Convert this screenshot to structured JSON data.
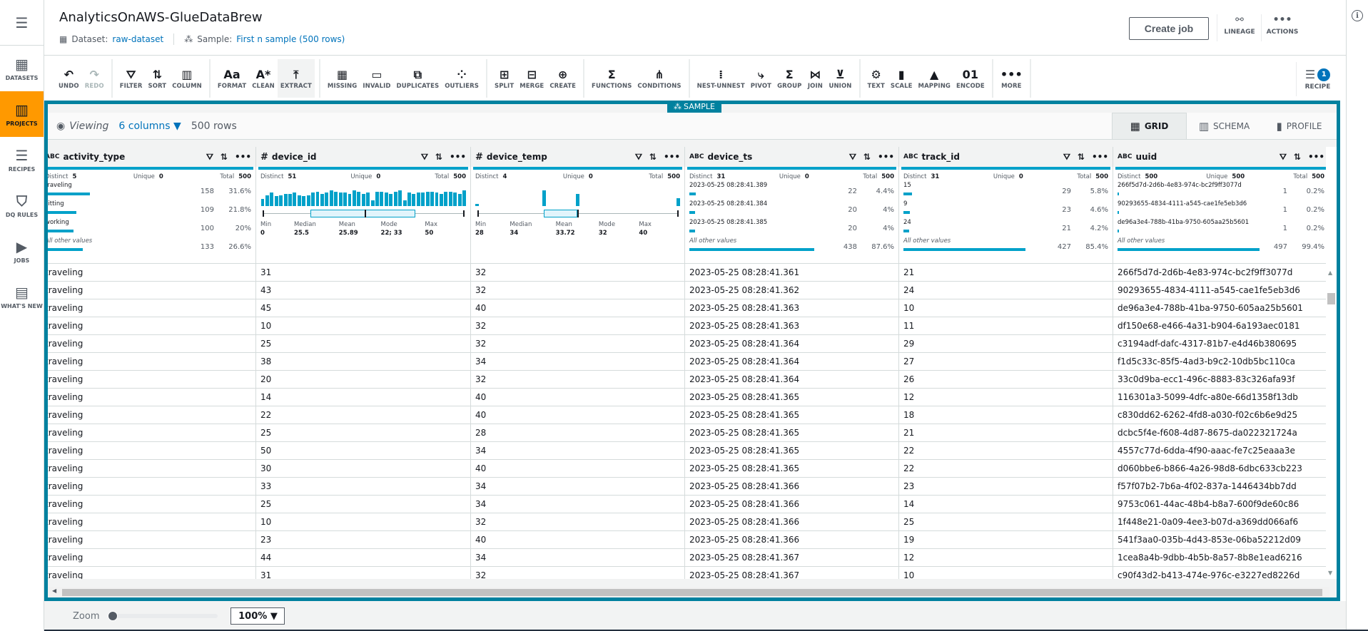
{
  "sidebar": {
    "menu_icon": "☰",
    "items": [
      {
        "label": "DATASETS",
        "icon": "datasets-icon",
        "active": false
      },
      {
        "label": "PROJECTS",
        "icon": "projects-icon",
        "active": true
      },
      {
        "label": "RECIPES",
        "icon": "recipes-icon",
        "active": false
      },
      {
        "label": "DQ RULES",
        "icon": "dq-rules-icon",
        "active": false
      },
      {
        "label": "JOBS",
        "icon": "jobs-icon",
        "active": false
      },
      {
        "label": "WHAT'S NEW",
        "icon": "whats-new-icon",
        "active": false
      }
    ]
  },
  "header": {
    "title": "AnalyticsOnAWS-GlueDataBrew",
    "dataset_label": "Dataset:",
    "dataset_value": "raw-dataset",
    "sample_label": "Sample:",
    "sample_value": "First n sample (500 rows)",
    "create_job": "Create job",
    "lineage": "LINEAGE",
    "actions": "ACTIONS"
  },
  "toolbar": {
    "groups": [
      [
        {
          "label": "UNDO",
          "icon": "↶",
          "disabled": false
        },
        {
          "label": "REDO",
          "icon": "↷",
          "disabled": true
        }
      ],
      [
        {
          "label": "FILTER",
          "icon": "⛛"
        },
        {
          "label": "SORT",
          "icon": "⇅"
        },
        {
          "label": "COLUMN",
          "icon": "▥"
        }
      ],
      [
        {
          "label": "FORMAT",
          "icon": "Aa"
        },
        {
          "label": "CLEAN",
          "icon": "A*"
        },
        {
          "label": "EXTRACT",
          "icon": "⤒",
          "active": true
        }
      ],
      [
        {
          "label": "MISSING",
          "icon": "▦"
        },
        {
          "label": "INVALID",
          "icon": "▭"
        },
        {
          "label": "DUPLICATES",
          "icon": "⧉"
        },
        {
          "label": "OUTLIERS",
          "icon": "⁘"
        }
      ],
      [
        {
          "label": "SPLIT",
          "icon": "⊞"
        },
        {
          "label": "MERGE",
          "icon": "⊟"
        },
        {
          "label": "CREATE",
          "icon": "⊕"
        }
      ],
      [
        {
          "label": "FUNCTIONS",
          "icon": "Σ"
        },
        {
          "label": "CONDITIONS",
          "icon": "⋔"
        }
      ],
      [
        {
          "label": "NEST-UNNEST",
          "icon": "⁞"
        },
        {
          "label": "PIVOT",
          "icon": "⤷"
        },
        {
          "label": "GROUP",
          "icon": "Σ"
        },
        {
          "label": "JOIN",
          "icon": "⋈"
        },
        {
          "label": "UNION",
          "icon": "⊻"
        }
      ],
      [
        {
          "label": "TEXT",
          "icon": "⚙"
        },
        {
          "label": "SCALE",
          "icon": "▮"
        },
        {
          "label": "MAPPING",
          "icon": "▲"
        },
        {
          "label": "ENCODE",
          "icon": "01"
        }
      ],
      [
        {
          "label": "MORE",
          "icon": "•••"
        }
      ]
    ],
    "recipe_label": "RECIPE",
    "recipe_count": "1"
  },
  "frame": {
    "sample_tag": "SAMPLE",
    "viewing": "Viewing",
    "columns_selector": "6 columns ▼",
    "rows": "500 rows",
    "view_tabs": [
      {
        "label": "GRID",
        "active": true
      },
      {
        "label": "SCHEMA",
        "active": false
      },
      {
        "label": "PROFILE",
        "active": false
      }
    ]
  },
  "columns": [
    {
      "name": "activity_type",
      "type": "ABC",
      "distinct": "5",
      "unique": "0",
      "total": "500",
      "top": [
        {
          "v": "traveling",
          "c": "158",
          "p": "31.6%",
          "f": 0.316
        },
        {
          "v": "sitting",
          "c": "109",
          "p": "21.8%",
          "f": 0.218
        },
        {
          "v": "working",
          "c": "100",
          "p": "20%",
          "f": 0.2
        },
        {
          "v": "All other values",
          "c": "133",
          "p": "26.6%",
          "f": 0.266,
          "other": true
        }
      ]
    },
    {
      "name": "device_id",
      "type": "#",
      "distinct": "51",
      "unique": "0",
      "total": "500",
      "numeric": {
        "min": "0",
        "median": "25.5",
        "mean": "25.89",
        "mode": "22; 33",
        "max": "50",
        "range": [
          0,
          50
        ],
        "q1": 12,
        "q3": 38,
        "med": 25.5
      },
      "hist": [
        6,
        9,
        11,
        8,
        9,
        10,
        10,
        11,
        9,
        8,
        9,
        11,
        12,
        10,
        11,
        13,
        12,
        11,
        11,
        10,
        13,
        12,
        10,
        11,
        5,
        12,
        12,
        11,
        10,
        12,
        13,
        5,
        11,
        10,
        11,
        11,
        12,
        12,
        11,
        10,
        12,
        12,
        11,
        10,
        13
      ]
    },
    {
      "name": "device_temp",
      "type": "#",
      "distinct": "4",
      "unique": "0",
      "total": "500",
      "numeric": {
        "min": "28",
        "median": "34",
        "mean": "33.72",
        "mode": "32",
        "max": "40",
        "range": [
          28,
          40
        ],
        "q1": 32,
        "q3": 34,
        "med": 34
      },
      "hist_bars": [
        {
          "x": 28,
          "h": 0.13
        },
        {
          "x": 32,
          "h": 1.0
        },
        {
          "x": 34,
          "h": 0.78
        },
        {
          "x": 40,
          "h": 0.5
        }
      ]
    },
    {
      "name": "device_ts",
      "type": "ABC",
      "distinct": "31",
      "unique": "0",
      "total": "500",
      "top": [
        {
          "v": "2023-05-25 08:28:41.389",
          "c": "22",
          "p": "4.4%",
          "f": 0.044
        },
        {
          "v": "2023-05-25 08:28:41.384",
          "c": "20",
          "p": "4%",
          "f": 0.04
        },
        {
          "v": "2023-05-25 08:28:41.385",
          "c": "20",
          "p": "4%",
          "f": 0.04
        },
        {
          "v": "All other values",
          "c": "438",
          "p": "87.6%",
          "f": 0.876,
          "other": true
        }
      ]
    },
    {
      "name": "track_id",
      "type": "ABC",
      "distinct": "31",
      "unique": "0",
      "total": "500",
      "top": [
        {
          "v": "15",
          "c": "29",
          "p": "5.8%",
          "f": 0.058
        },
        {
          "v": "9",
          "c": "23",
          "p": "4.6%",
          "f": 0.046
        },
        {
          "v": "24",
          "c": "21",
          "p": "4.2%",
          "f": 0.042
        },
        {
          "v": "All other values",
          "c": "427",
          "p": "85.4%",
          "f": 0.854,
          "other": true
        }
      ]
    },
    {
      "name": "uuid",
      "type": "ABC",
      "distinct": "500",
      "unique": "500",
      "total": "500",
      "top": [
        {
          "v": "266f5d7d-2d6b-4e83-974c-bc2f9ff3077d",
          "c": "1",
          "p": "0.2%",
          "f": 0.002
        },
        {
          "v": "90293655-4834-4111-a545-cae1fe5eb3d6",
          "c": "1",
          "p": "0.2%",
          "f": 0.002
        },
        {
          "v": "de96a3e4-788b-41ba-9750-605aa25b5601",
          "c": "1",
          "p": "0.2%",
          "f": 0.002
        },
        {
          "v": "All other values",
          "c": "497",
          "p": "99.4%",
          "f": 0.994,
          "other": true
        }
      ]
    }
  ],
  "stat_labels": {
    "distinct": "Distinct",
    "unique": "Unique",
    "total": "Total",
    "min": "Min",
    "median": "Median",
    "mean": "Mean",
    "mode": "Mode",
    "max": "Max"
  },
  "rows": [
    [
      "traveling",
      "31",
      "32",
      "2023-05-25 08:28:41.361",
      "21",
      "266f5d7d-2d6b-4e83-974c-bc2f9ff3077d"
    ],
    [
      "traveling",
      "43",
      "32",
      "2023-05-25 08:28:41.362",
      "24",
      "90293655-4834-4111-a545-cae1fe5eb3d6"
    ],
    [
      "traveling",
      "45",
      "40",
      "2023-05-25 08:28:41.363",
      "10",
      "de96a3e4-788b-41ba-9750-605aa25b5601"
    ],
    [
      "traveling",
      "10",
      "32",
      "2023-05-25 08:28:41.363",
      "11",
      "df150e68-e466-4a31-b904-6a193aec0181"
    ],
    [
      "traveling",
      "25",
      "32",
      "2023-05-25 08:28:41.364",
      "29",
      "c3194adf-dafc-4317-81b7-e4d46b380695"
    ],
    [
      "traveling",
      "38",
      "34",
      "2023-05-25 08:28:41.364",
      "27",
      "f1d5c33c-85f5-4ad3-b9c2-10db5bc110ca"
    ],
    [
      "traveling",
      "20",
      "32",
      "2023-05-25 08:28:41.364",
      "26",
      "33c0d9ba-ecc1-496c-8883-83c326afa93f"
    ],
    [
      "traveling",
      "14",
      "40",
      "2023-05-25 08:28:41.365",
      "12",
      "116301a3-5099-4dfc-a80e-66d1358f13db"
    ],
    [
      "traveling",
      "22",
      "40",
      "2023-05-25 08:28:41.365",
      "18",
      "c830dd62-6262-4fd8-a030-f02c6b6e9d25"
    ],
    [
      "traveling",
      "25",
      "28",
      "2023-05-25 08:28:41.365",
      "21",
      "dcbc5f4e-f608-4d87-8675-da022321724a"
    ],
    [
      "traveling",
      "50",
      "34",
      "2023-05-25 08:28:41.365",
      "22",
      "4557c77d-6dda-4f90-aaac-fe7c25eaaa3e"
    ],
    [
      "traveling",
      "30",
      "40",
      "2023-05-25 08:28:41.365",
      "22",
      "d060bbe6-b866-4a26-98d8-6dbc633cb223"
    ],
    [
      "traveling",
      "33",
      "34",
      "2023-05-25 08:28:41.366",
      "23",
      "f57f07b2-7b6a-4f02-837a-1446434bb7dd"
    ],
    [
      "traveling",
      "25",
      "34",
      "2023-05-25 08:28:41.366",
      "14",
      "9753c061-44ac-48b4-b8a7-600f9de60c86"
    ],
    [
      "traveling",
      "10",
      "32",
      "2023-05-25 08:28:41.366",
      "25",
      "1f448e21-0a09-4ee3-b07d-a369dd066af6"
    ],
    [
      "traveling",
      "23",
      "40",
      "2023-05-25 08:28:41.366",
      "19",
      "541f3aa0-035b-4d43-853e-06ba52212d09"
    ],
    [
      "traveling",
      "44",
      "34",
      "2023-05-25 08:28:41.367",
      "12",
      "1cea8a4b-9dbb-4b5b-8a57-8b8e1ead6216"
    ],
    [
      "traveling",
      "31",
      "32",
      "2023-05-25 08:28:41.367",
      "10",
      "c90f43d2-b413-474e-976c-e3227ed8226d"
    ]
  ],
  "zoom": {
    "label": "Zoom",
    "value": "100%",
    "level": 0
  }
}
